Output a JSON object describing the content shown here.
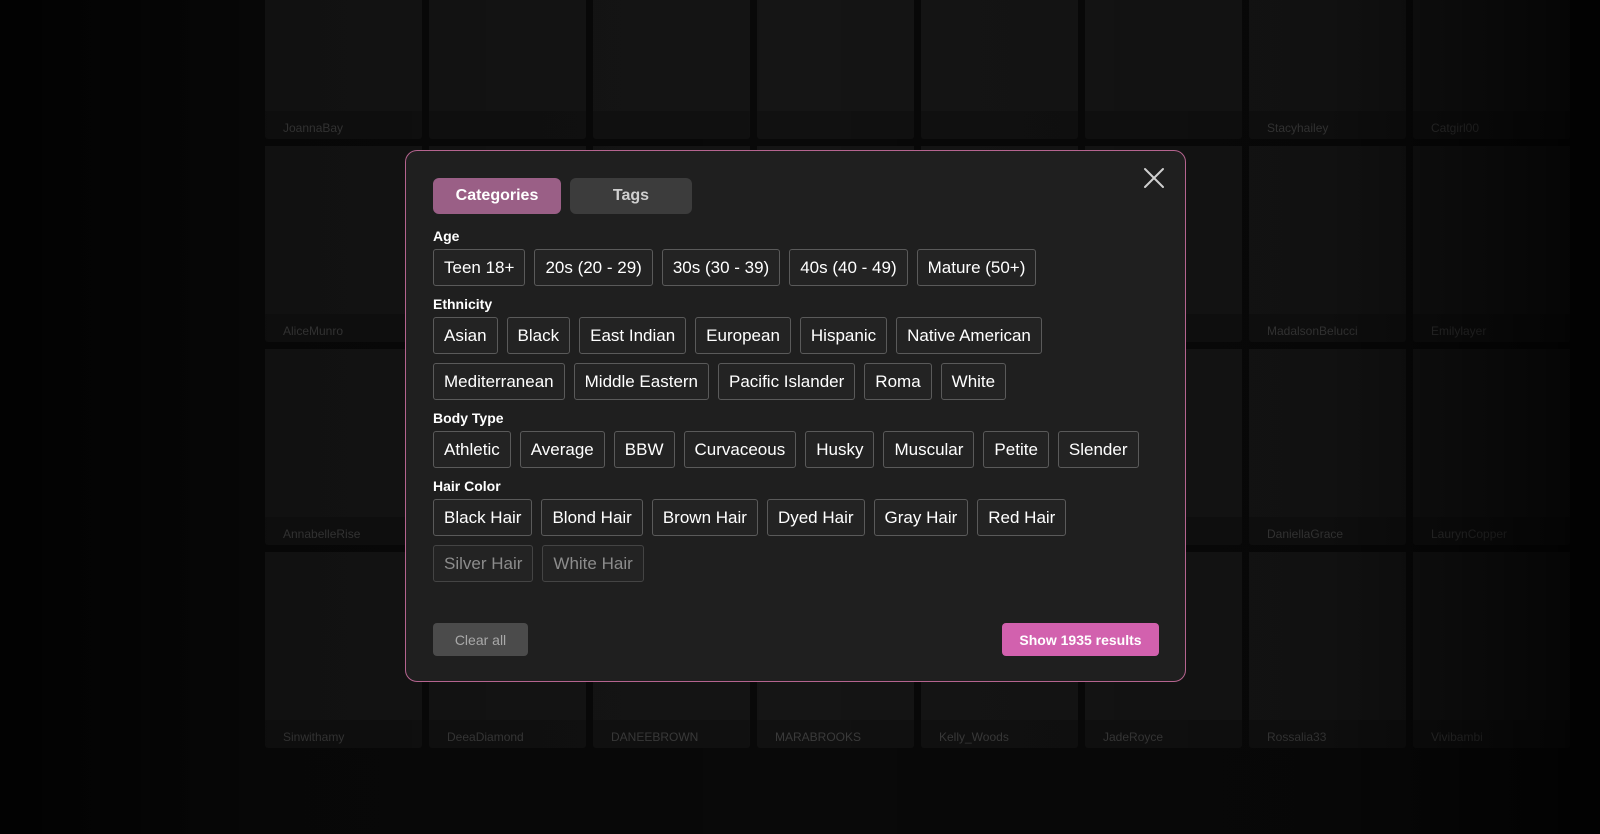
{
  "background": {
    "cards": [
      "JoannaBay",
      "",
      "",
      "",
      "",
      "",
      "Stacyhailey",
      "Catgirl00",
      "AliceMunro",
      "",
      "",
      "",
      "",
      "",
      "MadalsonBelucci",
      "Emilylayer",
      "AnnabelleRise",
      "",
      "",
      "",
      "",
      "",
      "DaniellaGrace",
      "LaurynCopper",
      "Sinwithamy",
      "DeeaDiamond",
      "DANEEBROWN",
      "MARABROOKS",
      "Kelly_Woods",
      "JadeRoyce",
      "Rossalia33",
      "Vivibambi"
    ]
  },
  "modal": {
    "tabs": {
      "categories": "Categories",
      "tags": "Tags"
    },
    "sections": {
      "age": {
        "title": "Age",
        "options": [
          "Teen 18+",
          "20s (20 - 29)",
          "30s (30 - 39)",
          "40s (40 - 49)",
          "Mature (50+)"
        ]
      },
      "ethnicity": {
        "title": "Ethnicity",
        "options": [
          "Asian",
          "Black",
          "East Indian",
          "European",
          "Hispanic",
          "Native American",
          "Mediterranean",
          "Middle Eastern",
          "Pacific Islander",
          "Roma",
          "White"
        ]
      },
      "body_type": {
        "title": "Body Type",
        "options": [
          "Athletic",
          "Average",
          "BBW",
          "Curvaceous",
          "Husky",
          "Muscular",
          "Petite",
          "Slender"
        ]
      },
      "hair_color": {
        "title": "Hair Color",
        "options": [
          "Black Hair",
          "Blond Hair",
          "Brown Hair",
          "Dyed Hair",
          "Gray Hair",
          "Red Hair",
          "Silver Hair",
          "White Hair"
        ]
      }
    },
    "clear_label": "Clear all",
    "show_label": "Show 1935 results"
  },
  "colors": {
    "accent_border": "#b5648f",
    "active_tab": "#9a5f86",
    "primary_button": "#d261ae"
  }
}
